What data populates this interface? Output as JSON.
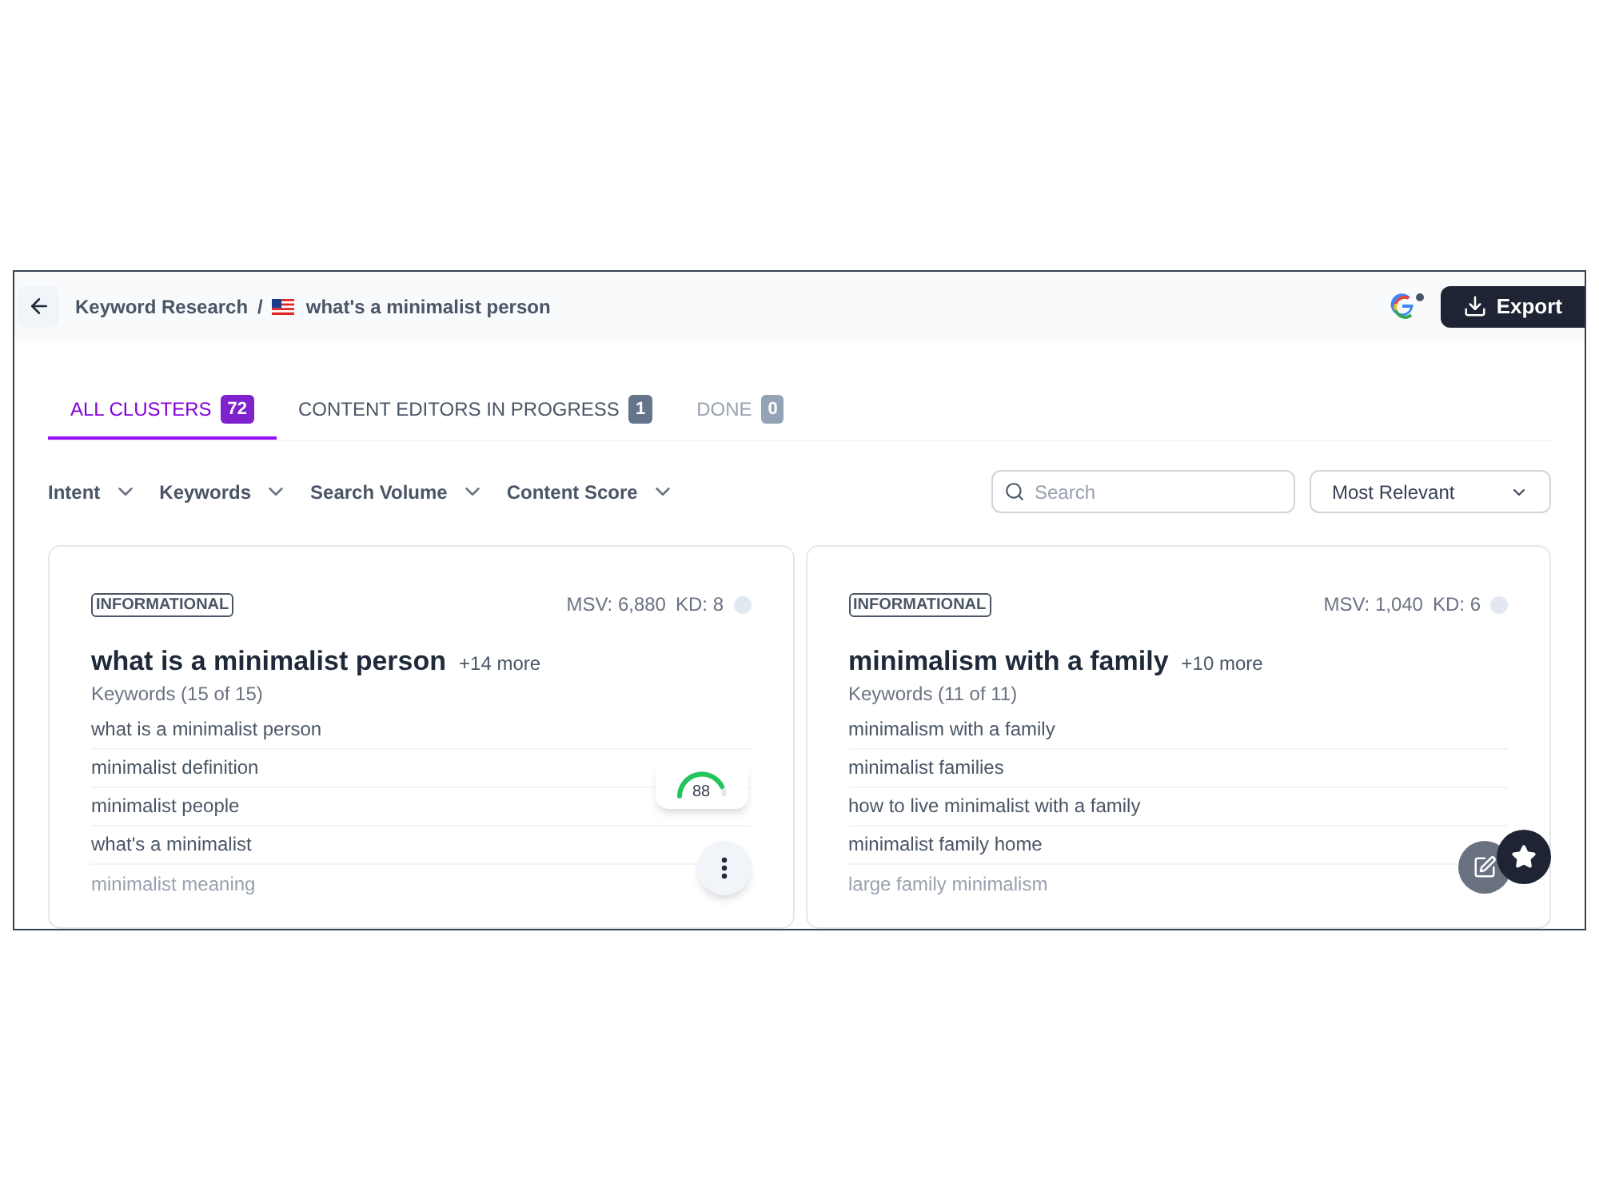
{
  "breadcrumb": {
    "parent": "Keyword Research",
    "separator": "/",
    "current": "what's a minimalist person"
  },
  "export_button": {
    "label": "Export"
  },
  "tabs": [
    {
      "label": "ALL CLUSTERS",
      "count": "72",
      "selected": true,
      "color": "#7e22ce"
    },
    {
      "label": "CONTENT EDITORS IN PROGRESS",
      "count": "1",
      "selected": false,
      "color": "#64748b"
    },
    {
      "label": "DONE",
      "count": "0",
      "selected": false,
      "color": "#94a3b8"
    }
  ],
  "filters": [
    "Intent",
    "Keywords",
    "Search Volume",
    "Content Score"
  ],
  "search": {
    "placeholder": "Search"
  },
  "sort": {
    "value": "Most Relevant"
  },
  "cards": [
    {
      "intent": "INFORMATIONAL",
      "msv": "MSV: 6,880",
      "kd": "KD: 8",
      "title": "what is a minimalist person",
      "more": "+14 more",
      "keywords_label": "Keywords (15 of 15)",
      "score": {
        "text": "88"
      },
      "keywords": [
        {
          "text": "what is a minimalist person",
          "faded": false
        },
        {
          "text": "minimalist definition",
          "faded": false
        },
        {
          "text": "minimalist people",
          "faded": false
        },
        {
          "text": "what's a minimalist",
          "faded": false
        },
        {
          "text": "minimalist meaning",
          "faded": true
        }
      ]
    },
    {
      "intent": "INFORMATIONAL",
      "msv": "MSV: 1,040",
      "kd": "KD: 6",
      "title": "minimalism with a family",
      "more": "+10 more",
      "keywords_label": "Keywords (11 of 11)",
      "keywords": [
        {
          "text": "minimalism with a family",
          "faded": false
        },
        {
          "text": "minimalist families",
          "faded": false
        },
        {
          "text": "how to live minimalist with a family",
          "faded": false
        },
        {
          "text": "minimalist family home",
          "faded": false
        },
        {
          "text": "large family minimalism",
          "faded": true
        }
      ]
    }
  ]
}
